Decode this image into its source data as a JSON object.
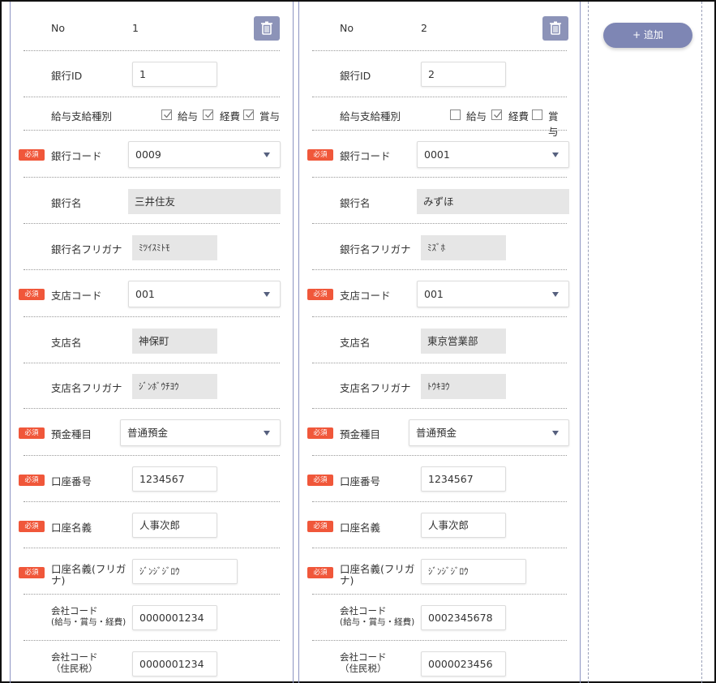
{
  "labels": {
    "no": "No",
    "bank_id": "銀行ID",
    "pay_type": "給与支給種別",
    "bank_code": "銀行コード",
    "bank_name": "銀行名",
    "bank_kana": "銀行名フリガナ",
    "branch_code": "支店コード",
    "branch_name": "支店名",
    "branch_kana": "支店名フリガナ",
    "deposit_type": "預金種目",
    "account_number": "口座番号",
    "account_holder": "口座名義",
    "account_holder_kana_1": "口座名義(フリガ",
    "account_holder_kana_2": "ナ)",
    "company_code_1_line1": "会社コード",
    "company_code_1_line2": "(給与・賞与・経費)",
    "company_code_2_line1": "会社コード",
    "company_code_2_line2": "（住民税）",
    "required": "必須",
    "cb_salary": "給与",
    "cb_expense": "経費",
    "cb_bonus": "賞与"
  },
  "add_button": "+ 追加",
  "records": [
    {
      "no": "1",
      "bank_id": "1",
      "checks": {
        "salary": true,
        "expense": true,
        "bonus": true
      },
      "bank_code": "0009",
      "bank_name": "三井住友",
      "bank_kana": "ﾐﾂｲｽﾐﾄﾓ",
      "branch_code": "001",
      "branch_name": "神保町",
      "branch_kana": "ｼﾞﾝﾎﾞｳﾁﾖｳ",
      "deposit_type": "普通預金",
      "account_number": "1234567",
      "account_holder": "人事次郎",
      "account_holder_kana": "ｼﾞﾝｼﾞｼﾞﾛｳ",
      "company_code_1": "0000001234",
      "company_code_2": "0000001234"
    },
    {
      "no": "2",
      "bank_id": "2",
      "checks": {
        "salary": false,
        "expense": true,
        "bonus": false
      },
      "bank_code": "0001",
      "bank_name": "みずほ",
      "bank_kana": "ﾐｽﾞﾎ",
      "branch_code": "001",
      "branch_name": "東京営業部",
      "branch_kana": "ﾄｳｷﾖｳ",
      "deposit_type": "普通預金",
      "account_number": "1234567",
      "account_holder": "人事次郎",
      "account_holder_kana": "ｼﾞﾝｼﾞｼﾞﾛｳ",
      "company_code_1": "0002345678",
      "company_code_2": "0000023456"
    }
  ],
  "colors": {
    "required_badge": "#f0573a",
    "accent": "#7e86b4",
    "readonly_bg": "#e6e6e6"
  }
}
